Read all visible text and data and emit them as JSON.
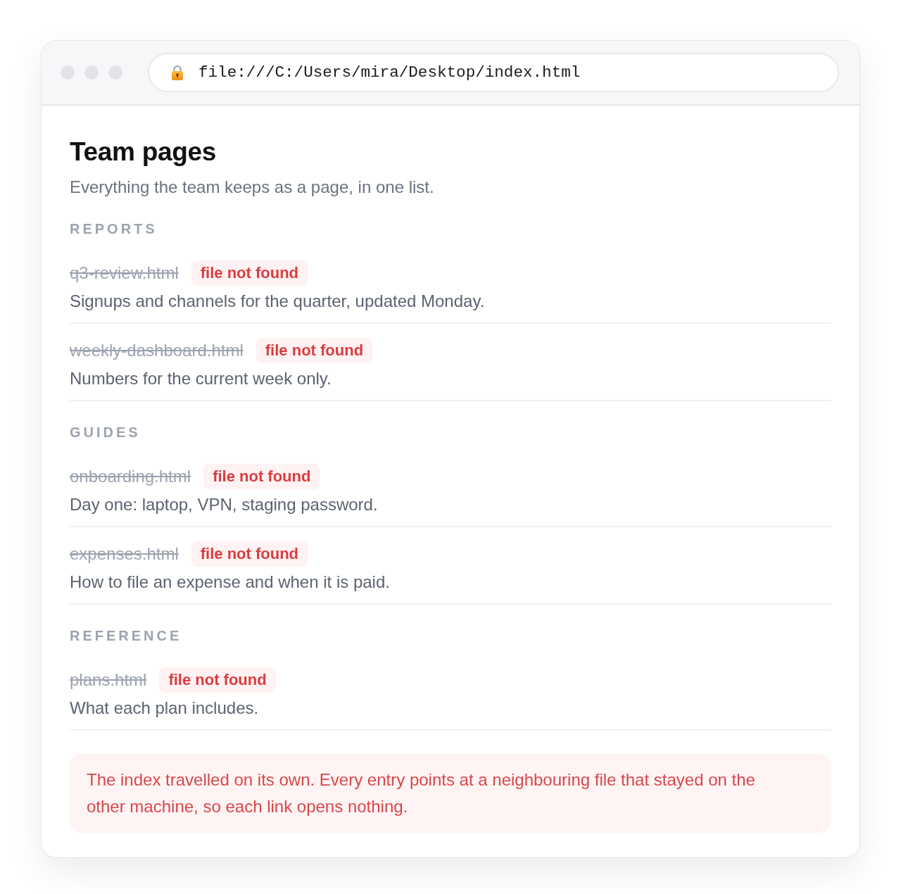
{
  "window": {
    "address": "file:///C:/Users/mira/Desktop/index.html"
  },
  "page": {
    "title": "Team pages",
    "subtitle": "Everything the team keeps as a page, in one list."
  },
  "sections": [
    {
      "heading": "REPORTS",
      "entries": [
        {
          "filename": "q3-review.html",
          "broken": true,
          "badge": "file not found",
          "description": "Signups and channels for the quarter, updated Monday."
        },
        {
          "filename": "weekly-dashboard.html",
          "broken": true,
          "badge": "file not found",
          "description": "Numbers for the current week only."
        }
      ]
    },
    {
      "heading": "GUIDES",
      "entries": [
        {
          "filename": "onboarding.html",
          "broken": true,
          "badge": "file not found",
          "description": "Day one: laptop, VPN, staging password."
        },
        {
          "filename": "expenses.html",
          "broken": true,
          "badge": "file not found",
          "description": "How to file an expense and when it is paid."
        }
      ]
    },
    {
      "heading": "REFERENCE",
      "entries": [
        {
          "filename": "plans.html",
          "broken": true,
          "badge": "file not found",
          "description": "What each plan includes."
        }
      ]
    }
  ],
  "notice": {
    "text": "The index travelled on its own. Every entry points at a neighbouring file that stayed on the other machine, so each link opens nothing."
  }
}
